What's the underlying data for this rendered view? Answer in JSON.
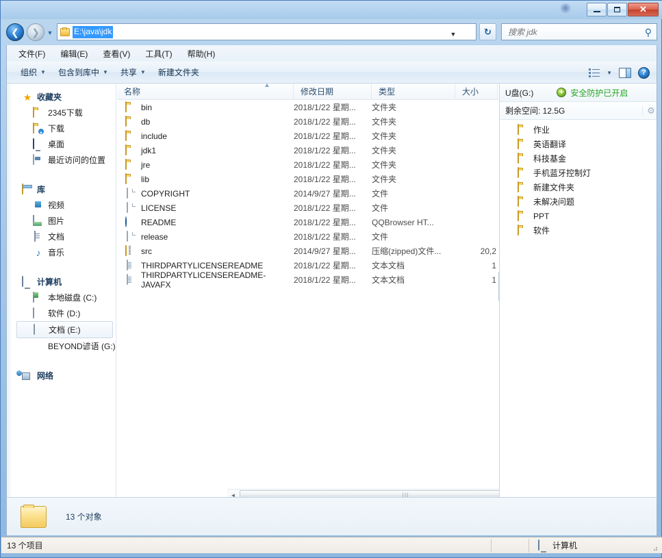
{
  "window": {
    "title": "",
    "minimize_label": "最小化",
    "maximize_label": "最大化",
    "close_label": "关闭"
  },
  "nav": {
    "back_label": "后退",
    "forward_label": "前进",
    "history_label": "最近浏览的位置",
    "address_value": "E:\\java\\jdk",
    "refresh_label": "刷新",
    "address_dropdown": "▼"
  },
  "search": {
    "placeholder": "搜索 jdk",
    "icon": "search-icon"
  },
  "menubar": {
    "items": [
      {
        "label": "文件(F)"
      },
      {
        "label": "编辑(E)"
      },
      {
        "label": "查看(V)"
      },
      {
        "label": "工具(T)"
      },
      {
        "label": "帮助(H)"
      }
    ]
  },
  "commandbar": {
    "items": [
      {
        "label": "组织",
        "caret": "▼"
      },
      {
        "label": "包含到库中",
        "caret": "▼"
      },
      {
        "label": "共享",
        "caret": "▼"
      },
      {
        "label": "新建文件夹",
        "caret": ""
      }
    ],
    "view_caret": "▼",
    "help_glyph": "?"
  },
  "sidebar": {
    "groups": [
      {
        "root": {
          "label": "收藏夹",
          "icon": "star-icon"
        },
        "items": [
          {
            "label": "2345下载",
            "icon": "folder-icon"
          },
          {
            "label": "下载",
            "icon": "downloads-icon"
          },
          {
            "label": "桌面",
            "icon": "desktop-icon"
          },
          {
            "label": "最近访问的位置",
            "icon": "recent-places-icon"
          }
        ]
      },
      {
        "root": {
          "label": "库",
          "icon": "library-icon"
        },
        "items": [
          {
            "label": "视频",
            "icon": "video-icon"
          },
          {
            "label": "图片",
            "icon": "pictures-icon"
          },
          {
            "label": "文档",
            "icon": "documents-icon"
          },
          {
            "label": "音乐",
            "icon": "music-icon"
          }
        ]
      },
      {
        "root": {
          "label": "计算机",
          "icon": "computer-icon"
        },
        "items": [
          {
            "label": "本地磁盘 (C:)",
            "icon": "system-drive-icon",
            "selected": false
          },
          {
            "label": "软件 (D:)",
            "icon": "hdd-icon",
            "selected": false
          },
          {
            "label": "文档 (E:)",
            "icon": "hdd-icon",
            "selected": true
          },
          {
            "label": "BEYOND谚语 (G:)",
            "icon": "usb-drive-icon",
            "selected": false
          }
        ]
      },
      {
        "root": {
          "label": "网络",
          "icon": "network-icon"
        },
        "items": []
      }
    ]
  },
  "filelist": {
    "columns": [
      {
        "label": "名称",
        "key": "name"
      },
      {
        "label": "修改日期",
        "key": "date"
      },
      {
        "label": "类型",
        "key": "type"
      },
      {
        "label": "大小",
        "key": "size"
      }
    ],
    "sort_column": "名称",
    "sort_direction": "ascending",
    "sort_arrow": "▲",
    "rows": [
      {
        "name": "bin",
        "date": "2018/1/22 星期...",
        "type": "文件夹",
        "size": "",
        "icon": "folder-icon"
      },
      {
        "name": "db",
        "date": "2018/1/22 星期...",
        "type": "文件夹",
        "size": "",
        "icon": "folder-icon"
      },
      {
        "name": "include",
        "date": "2018/1/22 星期...",
        "type": "文件夹",
        "size": "",
        "icon": "folder-icon"
      },
      {
        "name": "jdk1",
        "date": "2018/1/22 星期...",
        "type": "文件夹",
        "size": "",
        "icon": "folder-icon"
      },
      {
        "name": "jre",
        "date": "2018/1/22 星期...",
        "type": "文件夹",
        "size": "",
        "icon": "folder-icon"
      },
      {
        "name": "lib",
        "date": "2018/1/22 星期...",
        "type": "文件夹",
        "size": "",
        "icon": "folder-icon"
      },
      {
        "name": "COPYRIGHT",
        "date": "2014/9/27 星期...",
        "type": "文件",
        "size": "",
        "icon": "file-icon"
      },
      {
        "name": "LICENSE",
        "date": "2018/1/22 星期...",
        "type": "文件",
        "size": "",
        "icon": "file-icon"
      },
      {
        "name": "README",
        "date": "2018/1/22 星期...",
        "type": "QQBrowser HT...",
        "size": "",
        "icon": "qqbrowser-icon"
      },
      {
        "name": "release",
        "date": "2018/1/22 星期...",
        "type": "文件",
        "size": "",
        "icon": "file-icon"
      },
      {
        "name": "src",
        "date": "2014/9/27 星期...",
        "type": "压缩(zipped)文件...",
        "size": "20,2",
        "icon": "zip-icon"
      },
      {
        "name": "THIRDPARTYLICENSEREADME",
        "date": "2018/1/22 星期...",
        "type": "文本文档",
        "size": "1",
        "icon": "text-icon"
      },
      {
        "name": "THIRDPARTYLICENSEREADME-JAVAFX",
        "date": "2018/1/22 星期...",
        "type": "文本文档",
        "size": "1",
        "icon": "text-icon"
      }
    ],
    "hscroll": {
      "left_arrow": "◄",
      "right_arrow": "►",
      "thumb_grip": "|||"
    },
    "collapse_handle": "❯"
  },
  "usbpane": {
    "title": "U盘(G:)",
    "security_label": "安全防护已开启",
    "security_color": "#22a522",
    "shield_icon": "shield-plus-icon",
    "free_space_label": "剩余空间: 12.5G",
    "gear_icon": "gear-icon",
    "folders": [
      {
        "label": "作业"
      },
      {
        "label": "英语翻译"
      },
      {
        "label": "科技基金"
      },
      {
        "label": "手机蓝牙控制灯"
      },
      {
        "label": "新建文件夹"
      },
      {
        "label": "未解决问题"
      },
      {
        "label": "PPT"
      },
      {
        "label": "软件"
      }
    ]
  },
  "details": {
    "object_count": "13 个对象",
    "icon": "folder-large-icon"
  },
  "statusbar": {
    "left_text": "13 个项目",
    "right_text": "计算机",
    "right_icon": "computer-icon"
  },
  "colors": {
    "accent_blue": "#3399ff",
    "selection_blue": "#3399ff",
    "security_green": "#22a522",
    "folder_yellow": "#f8d164",
    "frame_blue": "#4a7ebb"
  }
}
